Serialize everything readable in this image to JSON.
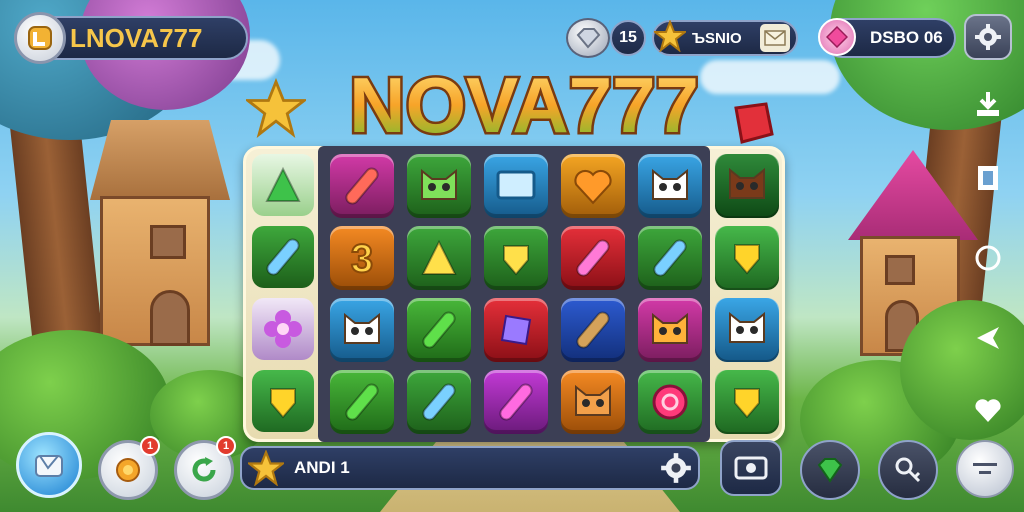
{
  "header": {
    "brand_label": "LNOVA777",
    "stat_value": "15",
    "star_value": "ЪSNIO",
    "gem_value": "DSBO 06"
  },
  "logo": {
    "title": "NOVA777"
  },
  "board": {
    "rows": [
      [
        "brush",
        "frog",
        "screen",
        "heart",
        "cat-white",
        "owl"
      ],
      [
        "3",
        "triangle-yellow",
        "bell",
        "stick-red",
        "capsule-blue",
        "shield-yellow"
      ],
      [
        "cat-white",
        "capsule-green",
        "gem-purple",
        "sword-blue",
        "cat-orange",
        "cat-blue"
      ],
      [
        "capsule-green",
        "capsule-blue",
        "stick-purple",
        "cat-glasses",
        "ring-pink",
        "shield-gold"
      ]
    ],
    "left_column": [
      "triangle-green",
      "capsule-blue",
      "flower-purple",
      "shield-yellow"
    ],
    "right_column": [
      "owl",
      "shield-yellow",
      "cat-blue",
      "shield-gold"
    ]
  },
  "bottom_bar": {
    "level_label": "ANDI 1",
    "badge_1": "1",
    "badge_2": "1"
  },
  "colors": {
    "accent": "#f2b233",
    "panel": "#1d2945",
    "board": "#3c3f55"
  },
  "icons": [
    "settings-icon",
    "mail-icon",
    "star-icon",
    "gem-icon",
    "heart-icon",
    "share-icon",
    "gift-icon"
  ]
}
